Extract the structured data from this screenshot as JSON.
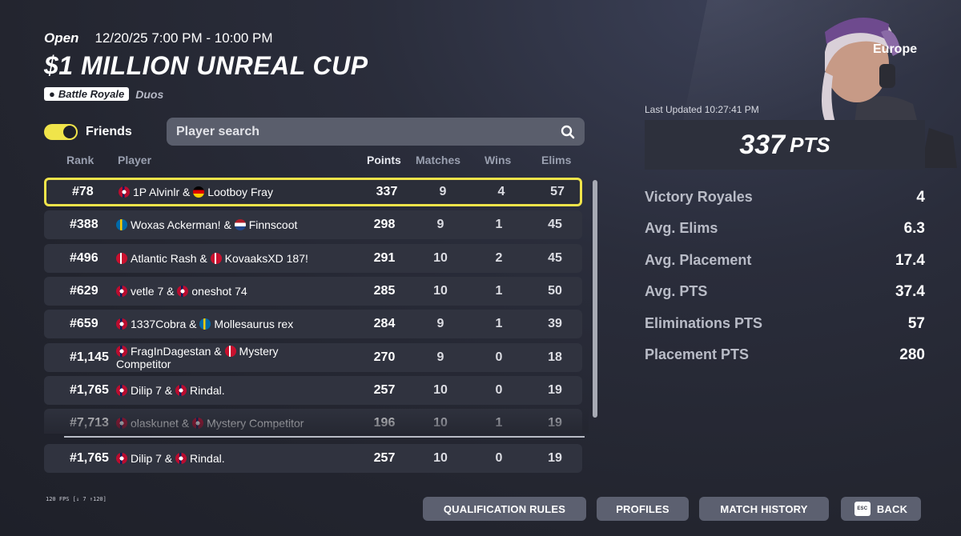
{
  "event": {
    "status": "Open",
    "time": "12/20/25 7:00 PM - 10:00 PM",
    "title": "$1 MILLION UNREAL CUP",
    "mode_badge": "Battle Royale",
    "mode_sub": "Duos",
    "region": "Europe"
  },
  "controls": {
    "friends_label": "Friends",
    "friends_toggle_on": true,
    "search_placeholder": "Player search"
  },
  "columns": {
    "rank": "Rank",
    "player": "Player",
    "points": "Points",
    "matches": "Matches",
    "wins": "Wins",
    "elims": "Elims"
  },
  "rows": [
    {
      "rank": "#78",
      "flag1": "norway",
      "p1": "1P Alvinlr",
      "flag2": "germany",
      "p2": "Lootboy Fray",
      "points": "337",
      "matches": "9",
      "wins": "4",
      "elims": "57"
    },
    {
      "rank": "#388",
      "flag1": "sweden",
      "p1": "Woxas Ackerman!",
      "flag2": "netherlands",
      "p2": "Finnscoot",
      "points": "298",
      "matches": "9",
      "wins": "1",
      "elims": "45"
    },
    {
      "rank": "#496",
      "flag1": "denmark",
      "p1": "Atlantic Rash",
      "flag2": "denmark",
      "p2": "KovaaksXD 187!",
      "points": "291",
      "matches": "10",
      "wins": "2",
      "elims": "45"
    },
    {
      "rank": "#629",
      "flag1": "norway",
      "p1": "vetle 7",
      "flag2": "norway",
      "p2": "oneshot 74",
      "points": "285",
      "matches": "10",
      "wins": "1",
      "elims": "50"
    },
    {
      "rank": "#659",
      "flag1": "norway",
      "p1": "1337Cobra",
      "flag2": "sweden",
      "p2": "Mollesaurus rex",
      "points": "284",
      "matches": "9",
      "wins": "1",
      "elims": "39"
    },
    {
      "rank": "#1,145",
      "flag1": "norway",
      "p1": "FragInDagestan",
      "flag2": "denmark",
      "p2": "Mystery Competitor",
      "points": "270",
      "matches": "9",
      "wins": "0",
      "elims": "18"
    },
    {
      "rank": "#1,765",
      "flag1": "norway",
      "p1": "Dilip 7",
      "flag2": "norway",
      "p2": "Rindal.",
      "points": "257",
      "matches": "10",
      "wins": "0",
      "elims": "19"
    },
    {
      "rank": "#7,713",
      "flag1": "norway",
      "p1": "olaskunet",
      "flag2": "norway",
      "p2": "Mystery Competitor",
      "points": "196",
      "matches": "10",
      "wins": "1",
      "elims": "19"
    }
  ],
  "pinned_row": {
    "rank": "#1,765",
    "flag1": "norway",
    "p1": "Dilip 7",
    "flag2": "norway",
    "p2": "Rindal.",
    "points": "257",
    "matches": "10",
    "wins": "0",
    "elims": "19"
  },
  "stats": {
    "last_updated": "Last Updated 10:27:41 PM",
    "total_points": "337",
    "points_unit": "PTS",
    "items": [
      {
        "label": "Victory Royales",
        "value": "4"
      },
      {
        "label": "Avg. Elims",
        "value": "6.3"
      },
      {
        "label": "Avg. Placement",
        "value": "17.4"
      },
      {
        "label": "Avg. PTS",
        "value": "37.4"
      },
      {
        "label": "Eliminations PTS",
        "value": "57"
      },
      {
        "label": "Placement PTS",
        "value": "280"
      }
    ]
  },
  "fps": "120 FPS [↓ 7 ↑120]",
  "buttons": {
    "qualification_rules": "QUALIFICATION RULES",
    "profiles": "PROFILES",
    "match_history": "MATCH HISTORY",
    "esc_key": "ESC",
    "back": "BACK"
  },
  "colors": {
    "accent_yellow": "#f0e44a",
    "row_bg": "#30333f",
    "button_bg": "#5c6070"
  }
}
